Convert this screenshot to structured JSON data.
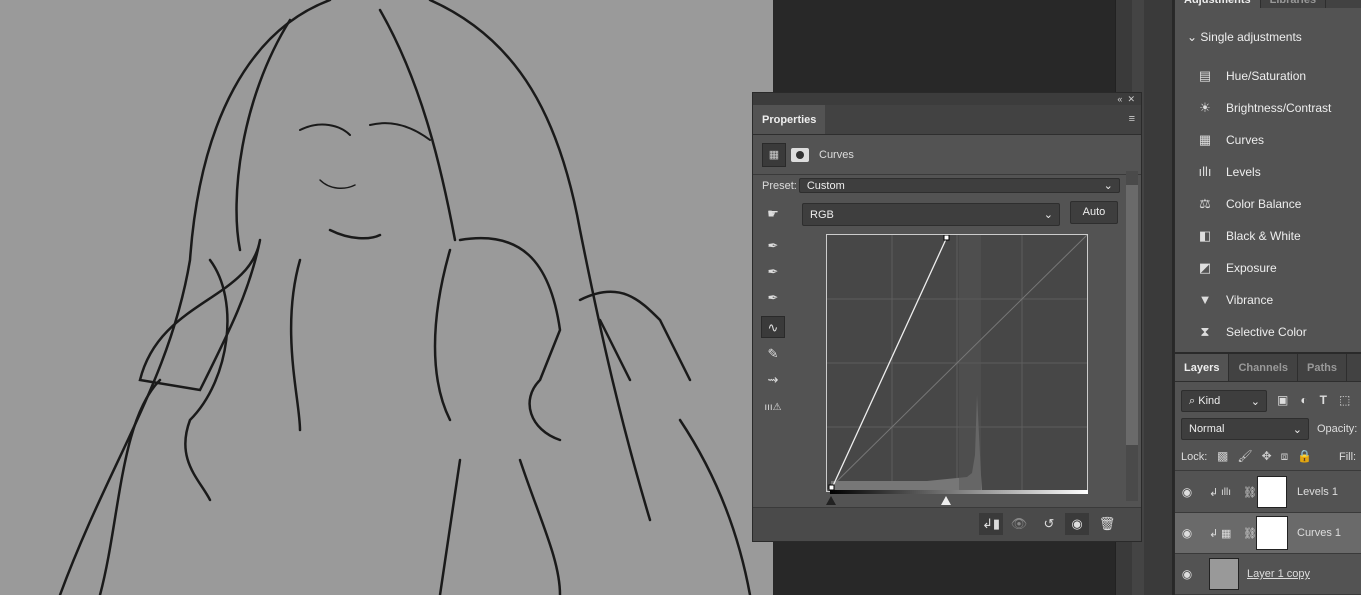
{
  "properties": {
    "tab": "Properties",
    "adjustment_name": "Curves",
    "preset_label": "Preset:",
    "preset_value": "Custom",
    "channel": "RGB",
    "auto_label": "Auto"
  },
  "adjustments": {
    "tabs": [
      "Adjustments",
      "Libraries"
    ],
    "section": "Single adjustments",
    "items": [
      {
        "label": "Hue/Saturation",
        "icon": "hue-saturation-icon"
      },
      {
        "label": "Brightness/Contrast",
        "icon": "brightness-icon"
      },
      {
        "label": "Curves",
        "icon": "curves-icon"
      },
      {
        "label": "Levels",
        "icon": "levels-icon"
      },
      {
        "label": "Color Balance",
        "icon": "color-balance-icon"
      },
      {
        "label": "Black & White",
        "icon": "black-white-icon"
      },
      {
        "label": "Exposure",
        "icon": "exposure-icon"
      },
      {
        "label": "Vibrance",
        "icon": "vibrance-icon"
      },
      {
        "label": "Selective Color",
        "icon": "selective-color-icon"
      }
    ]
  },
  "layers": {
    "tabs": [
      "Layers",
      "Channels",
      "Paths"
    ],
    "filter": "Kind",
    "blend": "Normal",
    "opacity_label": "Opacity:",
    "lock_label": "Lock:",
    "fill_label": "Fill:",
    "items": [
      {
        "name": "Levels 1"
      },
      {
        "name": "Curves 1"
      },
      {
        "name": "Layer 1 copy"
      }
    ]
  }
}
